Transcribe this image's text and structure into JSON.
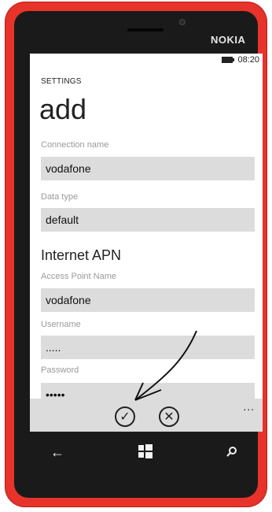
{
  "device": {
    "brand": "NOKIA"
  },
  "status_bar": {
    "time": "08:20"
  },
  "header": {
    "app_title": "SETTINGS",
    "page_title": "add"
  },
  "form": {
    "connection_name": {
      "label": "Connection name",
      "value": "vodafone"
    },
    "data_type": {
      "label": "Data type",
      "value": "default"
    },
    "internet_apn_heading": "Internet APN",
    "access_point_name": {
      "label": "Access Point Name",
      "value": "vodafone"
    },
    "username": {
      "label": "Username",
      "value": "....."
    },
    "password": {
      "label": "Password",
      "value": "•••••"
    }
  },
  "app_bar": {
    "save_icon": "check-circle",
    "cancel_icon": "x-circle",
    "more_label": "..."
  },
  "nav": {
    "back": "back-arrow",
    "start": "windows-logo",
    "search": "search"
  },
  "colors": {
    "phone_body": "#e8332a",
    "field_bg": "#dcdcdc",
    "appbar_bg": "#dcdcdc"
  }
}
